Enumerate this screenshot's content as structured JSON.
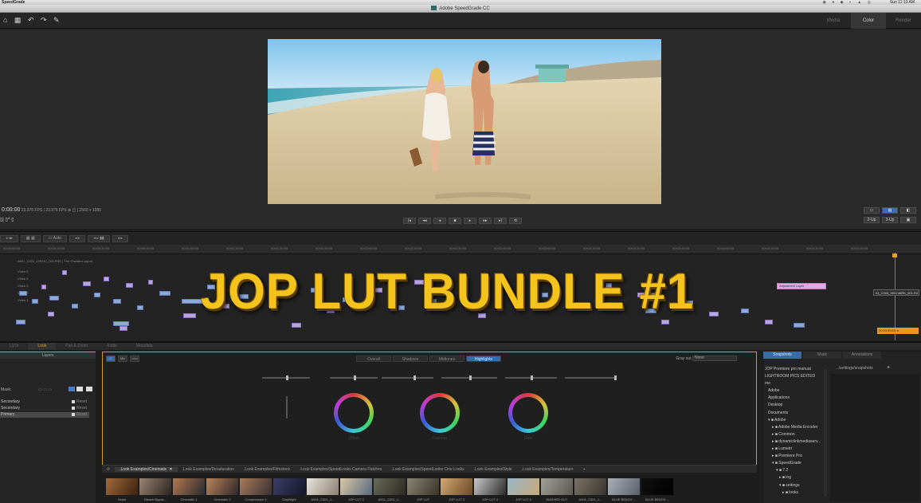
{
  "menubar": {
    "app": "SpeedGrade",
    "clock": "Sun 11:13 AM",
    "tray": "◉ ● ◆ ◐ ▲ ◎"
  },
  "window": {
    "title": "Adobe SpeedGrade CC"
  },
  "toolbar": {
    "tools": "⌂ ▦ ↶ ↷ ✎",
    "modes": [
      "Media",
      "Color",
      "Render"
    ],
    "active_mode": "Color"
  },
  "monitor": {
    "timecode": "0:00:00",
    "info": "23.976 FPS | 23.976 FPS ⊕ ◫ | 2560 x 1080",
    "transport": [
      "|◂",
      "◂◂",
      "◂",
      "■",
      "▸",
      "▸▸",
      "▸|",
      "⟲"
    ],
    "right_buttons_row1": [
      "▭",
      "▦",
      "◧"
    ],
    "right_buttons_row2": [
      "2-Up",
      "3-Up",
      "▣"
    ],
    "left_mini": "▯|  ▯^  ▯"
  },
  "timeline": {
    "controls": [
      "◂ ◂▸",
      "▦ ▦",
      "▭ Auto",
      "◂  ▸",
      "◂  ▸ ▮▮",
      "◂  ▸"
    ],
    "ruler": [
      "00:00:00:00",
      "00:00:15:00",
      "00:00:30:00",
      "00:00:45:00",
      "00:01:00:00",
      "00:01:15:00",
      "00:01:30:00",
      "00:01:45:00",
      "00:02:00:00",
      "00:02:15:00",
      "00:02:30:00",
      "00:02:45:00",
      "00:03:00:00",
      "00:03:15:00",
      "00:03:30:00",
      "00:03:45:00",
      "00:04:00:00",
      "00:04:15:00",
      "00:04:30:00",
      "00:04:45:00"
    ],
    "sequence_name": "A001_C001_1002JC_001.R3D | The Cheaters.prproj",
    "tracks": [
      "Video 5",
      "Video 4",
      "Video 3",
      "Video 2",
      "Video 1"
    ],
    "adjustment_layer": "Adjustment Layer",
    "timecode_box": "03_C003_HELIVARK_001.R3",
    "timecode_orange": "00:03:59:15 ◂",
    "overlay_title": "JOP LUT BUNDLE #1"
  },
  "bottom_tabs": [
    "LUTs",
    "Look",
    "Pan & Zoom",
    "Audio",
    "Metadata"
  ],
  "bottom_active_tab": "Look",
  "layers": {
    "header": "Layers",
    "mask_label": "Mask:",
    "rows": [
      {
        "name": "Secondary",
        "reset": "Reset"
      },
      {
        "name": "Secondary",
        "reset": "Reset"
      },
      {
        "name": "Primary",
        "reset": "Reset"
      }
    ]
  },
  "color": {
    "left_buttons": [
      "C",
      "Mix",
      "▭▭"
    ],
    "tabs": [
      "Overall",
      "Shadows",
      "Midtones",
      "Highlights"
    ],
    "active_tab": "Highlights",
    "grayout_label": "Gray out",
    "grayout_value": "None",
    "wheel_labels": [
      "Offset",
      "Gamma",
      "Gain"
    ]
  },
  "look_tabs": [
    {
      "label": ".Look Examples/Cinematic",
      "close": "✕"
    },
    {
      "label": ".Look Examples/Desaturation"
    },
    {
      "label": ".Look Examples/Filmstock"
    },
    {
      "label": ".Look Examples/SpeedLooks Camera Patches"
    },
    {
      "label": ".Look Examples/SpeedLooks Cine Looks"
    },
    {
      "label": ".Look Examples/Style"
    },
    {
      "label": ".Look Examples/Temperature"
    },
    {
      "label": "+"
    }
  ],
  "looks": [
    {
      "name": "Sepia",
      "c1": "#a26a3a",
      "c2": "#3a2210"
    },
    {
      "name": "Bleach Bypas...",
      "c1": "#9a8470",
      "c2": "#2a2420"
    },
    {
      "name": "Cinematic 1",
      "c1": "#b07850",
      "c2": "#2c2a30"
    },
    {
      "name": "Cinematic 2",
      "c1": "#b8845a",
      "c2": "#30282a"
    },
    {
      "name": "Compression 3",
      "c1": "#a87a5a",
      "c2": "#3a3034"
    },
    {
      "name": "DayWight",
      "c1": "#3a3e66",
      "c2": "#15162a"
    },
    {
      "name": "A001_C001_1...",
      "c1": "#e8e4dc",
      "c2": "#8a8070"
    },
    {
      "name": "JOP LUT 2",
      "c1": "#d8c8a4",
      "c2": "#5a6a80"
    },
    {
      "name": "A001_C001_1...",
      "c1": "#6a6a58",
      "c2": "#2a2a22"
    },
    {
      "name": "JOP LUT",
      "c1": "#8a8474",
      "c2": "#3a3428"
    },
    {
      "name": "JOP LUT 3",
      "c1": "#d4a870",
      "c2": "#6a4a2a"
    },
    {
      "name": "JOP LUT 4",
      "c1": "#c8c8c8",
      "c2": "#2a2a2a"
    },
    {
      "name": "JOP LUT 5",
      "c1": "#9ab8c8",
      "c2": "#c8a878"
    },
    {
      "name": "WASHED OUT",
      "c1": "#a0a098",
      "c2": "#5a5a52"
    },
    {
      "name": "A001_C001_1...",
      "c1": "#7a7466",
      "c2": "#3a3430"
    },
    {
      "name": "BLUE BEACH ...",
      "c1": "#a8b0b8",
      "c2": "#5a6068"
    },
    {
      "name": "BLUE BEACH ...",
      "c1": "#101010",
      "c2": "#000000"
    }
  ],
  "right_panel": {
    "tabs": [
      "Snapshots",
      "Mask",
      "Annotations"
    ],
    "active_tab": "Snapshots",
    "snapshot_path": "../settings/snapshots",
    "snapshot_add": "+",
    "tree": [
      {
        "label": "JOP Premiere pro manual",
        "level": 0
      },
      {
        "label": "LIGHTROOM PICS EDITED",
        "level": 0
      },
      {
        "label": "me",
        "level": 0
      },
      {
        "label": "Adobe",
        "level": 1
      },
      {
        "label": "Applications",
        "level": 1
      },
      {
        "label": "Desktop",
        "level": 1
      },
      {
        "label": "Documents",
        "level": 1
      },
      {
        "label": "▾ ■ Adobe",
        "level": 1
      },
      {
        "label": "▸ ■ Adobe Media Encoder",
        "level": 2
      },
      {
        "label": "▸ ■ Common",
        "level": 2
      },
      {
        "label": "▸ ■ dynamiclinkmediaserv...",
        "level": 2
      },
      {
        "label": "▸ ■ Lumetri",
        "level": 2
      },
      {
        "label": "▸ ■ Premiere Pro",
        "level": 2
      },
      {
        "label": "▾ ■ SpeedGrade",
        "level": 2
      },
      {
        "label": "▾ ■ 7.2",
        "level": 3
      },
      {
        "label": "▸ ■ log",
        "level": 4
      },
      {
        "label": "▾ ■ settings",
        "level": 4
      },
      {
        "label": "▸ ■ looks",
        "level": 5
      }
    ]
  }
}
